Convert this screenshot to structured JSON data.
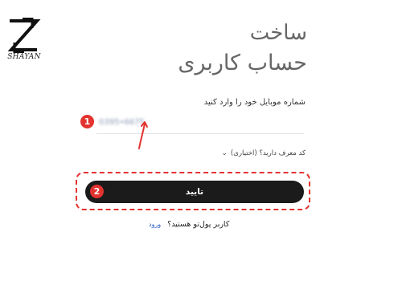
{
  "brand": {
    "logo_text": "SHAYAN"
  },
  "page": {
    "title_line1": "ساخت",
    "title_line2": "حساب کاربری"
  },
  "form": {
    "phone_label": "شماره موبایل خود را وارد کنید",
    "phone_value": "0395•6675",
    "referral_label": "کد معرف دارید؟ (اختیاری)",
    "referral_icon": "chevron-down-icon",
    "submit_label": "تایید",
    "existing_user_text": "کاربر پول‌تو هستید؟",
    "login_link": "ورود"
  },
  "annotations": {
    "step1": "1",
    "step2": "2",
    "color": "#e3332f"
  }
}
